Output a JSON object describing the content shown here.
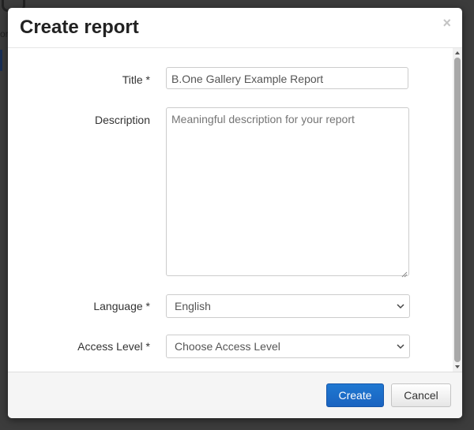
{
  "dialog": {
    "title": "Create report",
    "close_symbol": "×"
  },
  "form": {
    "title": {
      "label": "Title *",
      "value": "B.One Gallery Example Report"
    },
    "description": {
      "label": "Description",
      "placeholder": "Meaningful description for your report"
    },
    "language": {
      "label": "Language *",
      "selected": "English"
    },
    "access_level": {
      "label": "Access Level *",
      "selected": "Choose Access Level"
    }
  },
  "footer": {
    "create_label": "Create",
    "cancel_label": "Cancel"
  },
  "colors": {
    "primary": "#1a63c0",
    "backdrop": "#3c3c3c"
  },
  "icons": {
    "close": "close-icon",
    "chevron": "chevron-down-icon",
    "resize": "resize-grip-icon"
  }
}
